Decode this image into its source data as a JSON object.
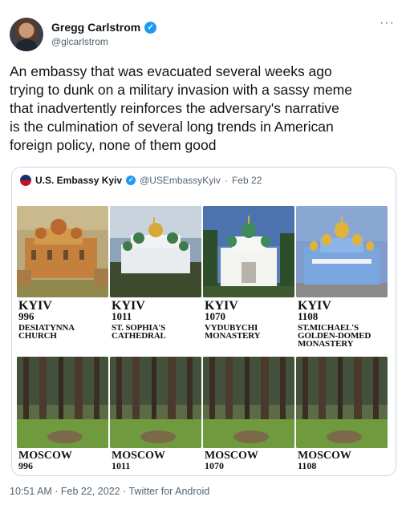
{
  "tweet": {
    "author_name": "Gregg Carlstrom",
    "author_handle": "@glcarlstrom",
    "verified": true,
    "more_icon": "more-horizontal-icon",
    "text": "An embassy that was evacuated several weeks ago\ntrying to dunk on a military invasion with a sassy meme\nthat inadvertently reinforces the adversary's narrative\nis the culmination of several long trends in American\nforeign policy, none of them good",
    "timestamp": "10:51 AM · Feb 22, 2022 · Twitter for Android"
  },
  "quoted": {
    "name": "U.S. Embassy Kyiv",
    "handle": "@USEmbassyKyiv",
    "separator": "·",
    "date": "Feb 22",
    "verified": true,
    "meme": {
      "top": [
        {
          "city": "KYIV",
          "year": "996",
          "place": "DESIATYNNA\nCHURCH"
        },
        {
          "city": "KYIV",
          "year": "1011",
          "place": "ST. SOPHIA'S\nCATHEDRAL"
        },
        {
          "city": "KYIV",
          "year": "1070",
          "place": "VYDUBYCHI\nMONASTERY"
        },
        {
          "city": "KYIV",
          "year": "1108",
          "place": "ST.MICHAEL'S\nGOLDEN-DOMED\nMONASTERY"
        }
      ],
      "bottom": [
        {
          "city": "MOSCOW",
          "year": "996"
        },
        {
          "city": "MOSCOW",
          "year": "1011"
        },
        {
          "city": "MOSCOW",
          "year": "1070"
        },
        {
          "city": "MOSCOW",
          "year": "1108"
        }
      ]
    }
  },
  "colors": {
    "accent": "#1d9bf0",
    "text": "#0f1419",
    "secondary": "#536471",
    "border": "#cfd9de"
  }
}
